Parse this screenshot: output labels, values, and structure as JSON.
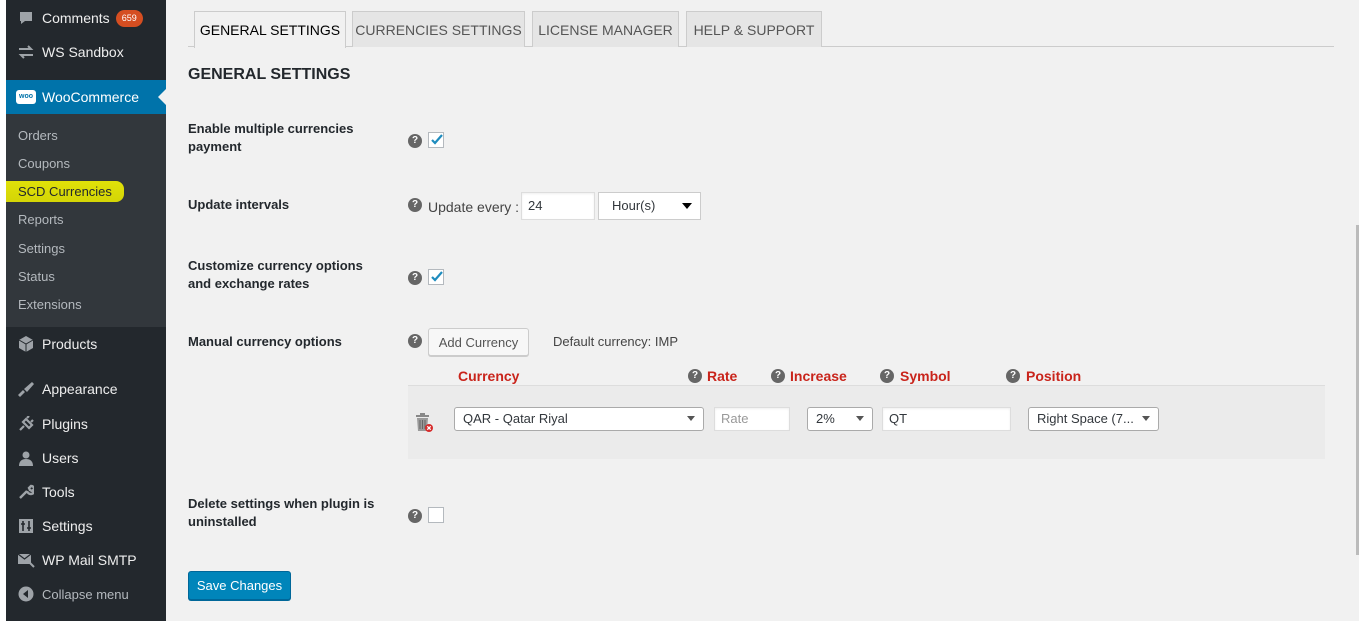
{
  "sidebar": {
    "items_top": [
      {
        "label": "Comments",
        "badge": "659",
        "icon": "comment-icon"
      },
      {
        "label": "WS Sandbox",
        "icon": "sandbox-icon"
      }
    ],
    "woocommerce": {
      "label": "WooCommerce",
      "icon": "woo-icon",
      "icon_text": "woo"
    },
    "submenu": [
      "Orders",
      "Coupons",
      "SCD Currencies",
      "Reports",
      "Settings",
      "Status",
      "Extensions"
    ],
    "current_submenu": "SCD Currencies",
    "items_bottom": [
      {
        "label": "Products",
        "icon": "products-icon"
      },
      {
        "label": "Appearance",
        "icon": "appearance-icon"
      },
      {
        "label": "Plugins",
        "icon": "plugins-icon"
      },
      {
        "label": "Users",
        "icon": "users-icon"
      },
      {
        "label": "Tools",
        "icon": "tools-icon"
      },
      {
        "label": "Settings",
        "icon": "settings-icon"
      },
      {
        "label": "WP Mail SMTP",
        "icon": "mail-icon"
      },
      {
        "label": "Collapse menu",
        "icon": "collapse-icon"
      }
    ]
  },
  "tabs": [
    "GENERAL SETTINGS",
    "CURRENCIES SETTINGS",
    "LICENSE MANAGER",
    "HELP & SUPPORT"
  ],
  "active_tab": "GENERAL SETTINGS",
  "heading": "GENERAL SETTINGS",
  "settings": {
    "multi_currency": {
      "label": "Enable multiple currencies payment",
      "checked": true
    },
    "update_intervals": {
      "label": "Update intervals",
      "prefix": "Update every :",
      "value": "24",
      "unit": "Hour(s)"
    },
    "customize": {
      "label": "Customize currency options and exchange rates",
      "checked": true
    },
    "manual": {
      "label": "Manual currency options",
      "add_button": "Add Currency",
      "default_label": "Default currency:",
      "default_value": "IMP"
    },
    "delete": {
      "label": "Delete settings when plugin is uninstalled",
      "checked": false
    }
  },
  "currency_table": {
    "headers": [
      "Currency",
      "Rate",
      "Increase",
      "Symbol",
      "Position"
    ],
    "row": {
      "currency": "QAR - Qatar Riyal",
      "rate_placeholder": "Rate",
      "increase": "2%",
      "symbol": "QT",
      "position": "Right Space (7..."
    }
  },
  "help_glyph": "?",
  "save_button": "Save Changes",
  "colors": {
    "sidebar": "#23282d",
    "submenu": "#32373c",
    "accent": "#0073aa",
    "header_red": "#c9241b",
    "highlight": "#ffff00"
  }
}
